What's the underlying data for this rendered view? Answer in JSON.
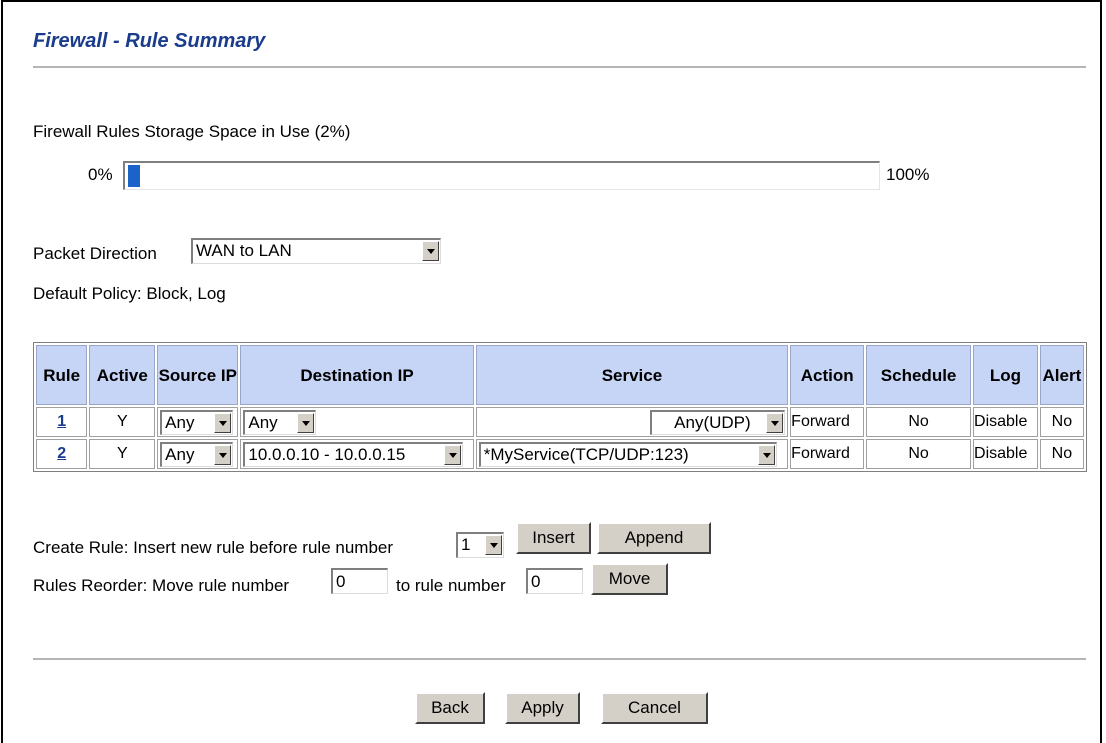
{
  "page": {
    "title": "Firewall - Rule Summary"
  },
  "storage": {
    "label": "Firewall Rules Storage Space in Use  (2%)",
    "min_label": "0%",
    "max_label": "100%",
    "used_fraction": 0.02
  },
  "direction": {
    "label": "Packet Direction",
    "selected": "WAN to LAN"
  },
  "default_policy": "Default Policy: Block, Log",
  "table": {
    "headers": {
      "rule": "Rule",
      "active": "Active",
      "source_ip": "Source IP",
      "destination_ip": "Destination IP",
      "service": "Service",
      "action": "Action",
      "schedule": "Schedule",
      "log": "Log",
      "alert": "Alert"
    },
    "rows": [
      {
        "rule": "1",
        "active": "Y",
        "source_ip": "Any",
        "destination_ip": "Any",
        "service": "Any(UDP)",
        "action": "Forward",
        "schedule": "No",
        "log": "Disable",
        "alert": "No"
      },
      {
        "rule": "2",
        "active": "Y",
        "source_ip": "Any",
        "destination_ip": "10.0.0.10 - 10.0.0.15",
        "service": "*MyService(TCP/UDP:123)",
        "action": "Forward",
        "schedule": "No",
        "log": "Disable",
        "alert": "No"
      }
    ]
  },
  "create_rule": {
    "label": "Create Rule: Insert new rule before rule number",
    "selected": "1",
    "insert_label": "Insert",
    "append_label": "Append"
  },
  "reorder": {
    "label": "Rules Reorder: Move rule number",
    "from_value": "0",
    "to_label": "to rule number",
    "to_value": "0",
    "move_label": "Move"
  },
  "footer": {
    "back_label": "Back",
    "apply_label": "Apply",
    "cancel_label": "Cancel"
  }
}
